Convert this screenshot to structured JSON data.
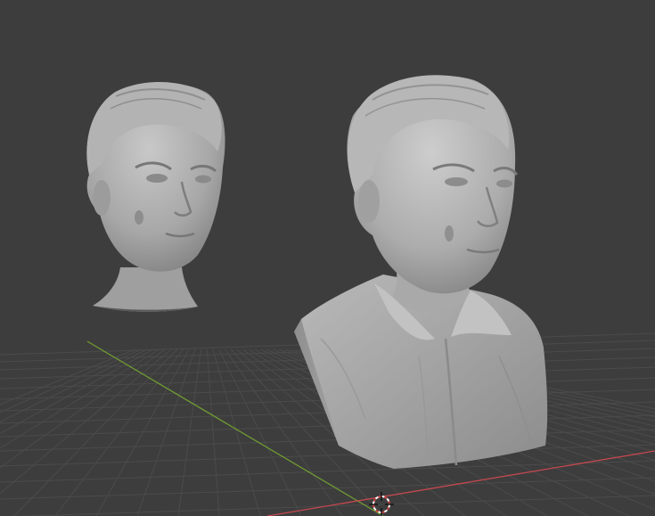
{
  "viewport": {
    "background_color": "#3d3d3d",
    "grid_color": "#4b4b4b",
    "x_axis_color": "#c4484f",
    "y_axis_color": "#6f9a32",
    "mesh_color": "#a9a9a9",
    "cursor_colors": [
      "#c94040",
      "#ffffff"
    ]
  },
  "objects": [
    {
      "name": "head-sculpt",
      "icon": "mesh-object"
    },
    {
      "name": "bust-sculpt",
      "icon": "mesh-object"
    }
  ],
  "cursor": {
    "icon": "3d-cursor-icon"
  }
}
